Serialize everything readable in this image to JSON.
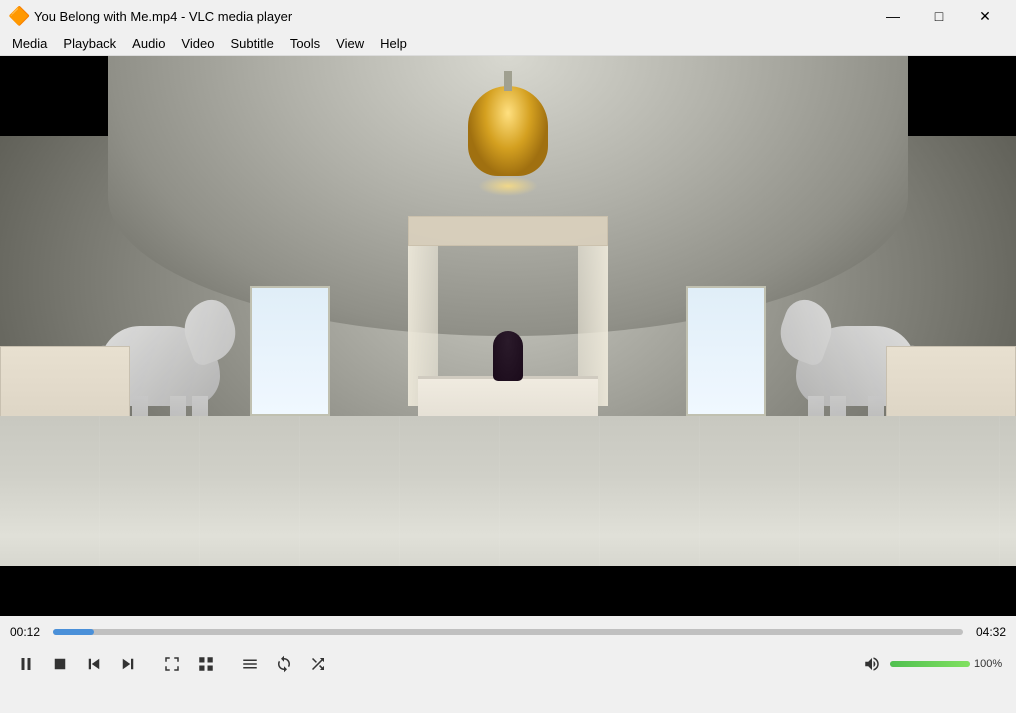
{
  "window": {
    "title": "You Belong with Me.mp4 - VLC media player",
    "icon": "🔶"
  },
  "menu": {
    "items": [
      "Media",
      "Playback",
      "Audio",
      "Video",
      "Subtitle",
      "Tools",
      "View",
      "Help"
    ]
  },
  "controls": {
    "time_current": "00:12",
    "time_total": "04:32",
    "progress_percent": 4.5,
    "volume_percent": 100,
    "volume_label": "100%",
    "buttons": {
      "pause": "⏸",
      "stop": "⏹",
      "prev": "⏮",
      "next": "⏭",
      "fullscreen": "⛶",
      "extended": "🔲",
      "playlist": "☰",
      "loop": "🔁",
      "random": "🔀",
      "volume_icon": "🔊"
    }
  },
  "window_controls": {
    "minimize": "—",
    "maximize": "□",
    "close": "✕"
  }
}
